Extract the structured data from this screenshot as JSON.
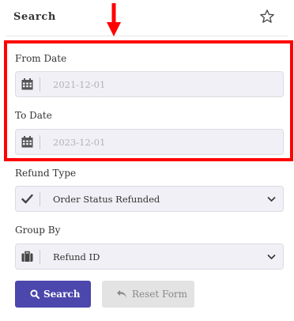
{
  "header": {
    "title": "Search",
    "star_icon": "star-outline-icon"
  },
  "form": {
    "from_date": {
      "label": "From Date",
      "placeholder": "2021-12-01",
      "icon": "calendar-icon"
    },
    "to_date": {
      "label": "To Date",
      "placeholder": "2023-12-01",
      "icon": "calendar-icon"
    },
    "refund_type": {
      "label": "Refund Type",
      "selected": "Order Status Refunded",
      "icon": "check-icon"
    },
    "group_by": {
      "label": "Group By",
      "selected": "Refund ID",
      "icon": "briefcase-icon"
    }
  },
  "buttons": {
    "search_label": "Search",
    "reset_label": "Reset Form"
  },
  "colors": {
    "highlight": "#ff0000",
    "primary": "#4b47ac",
    "field_bg": "#f1f0f6"
  }
}
